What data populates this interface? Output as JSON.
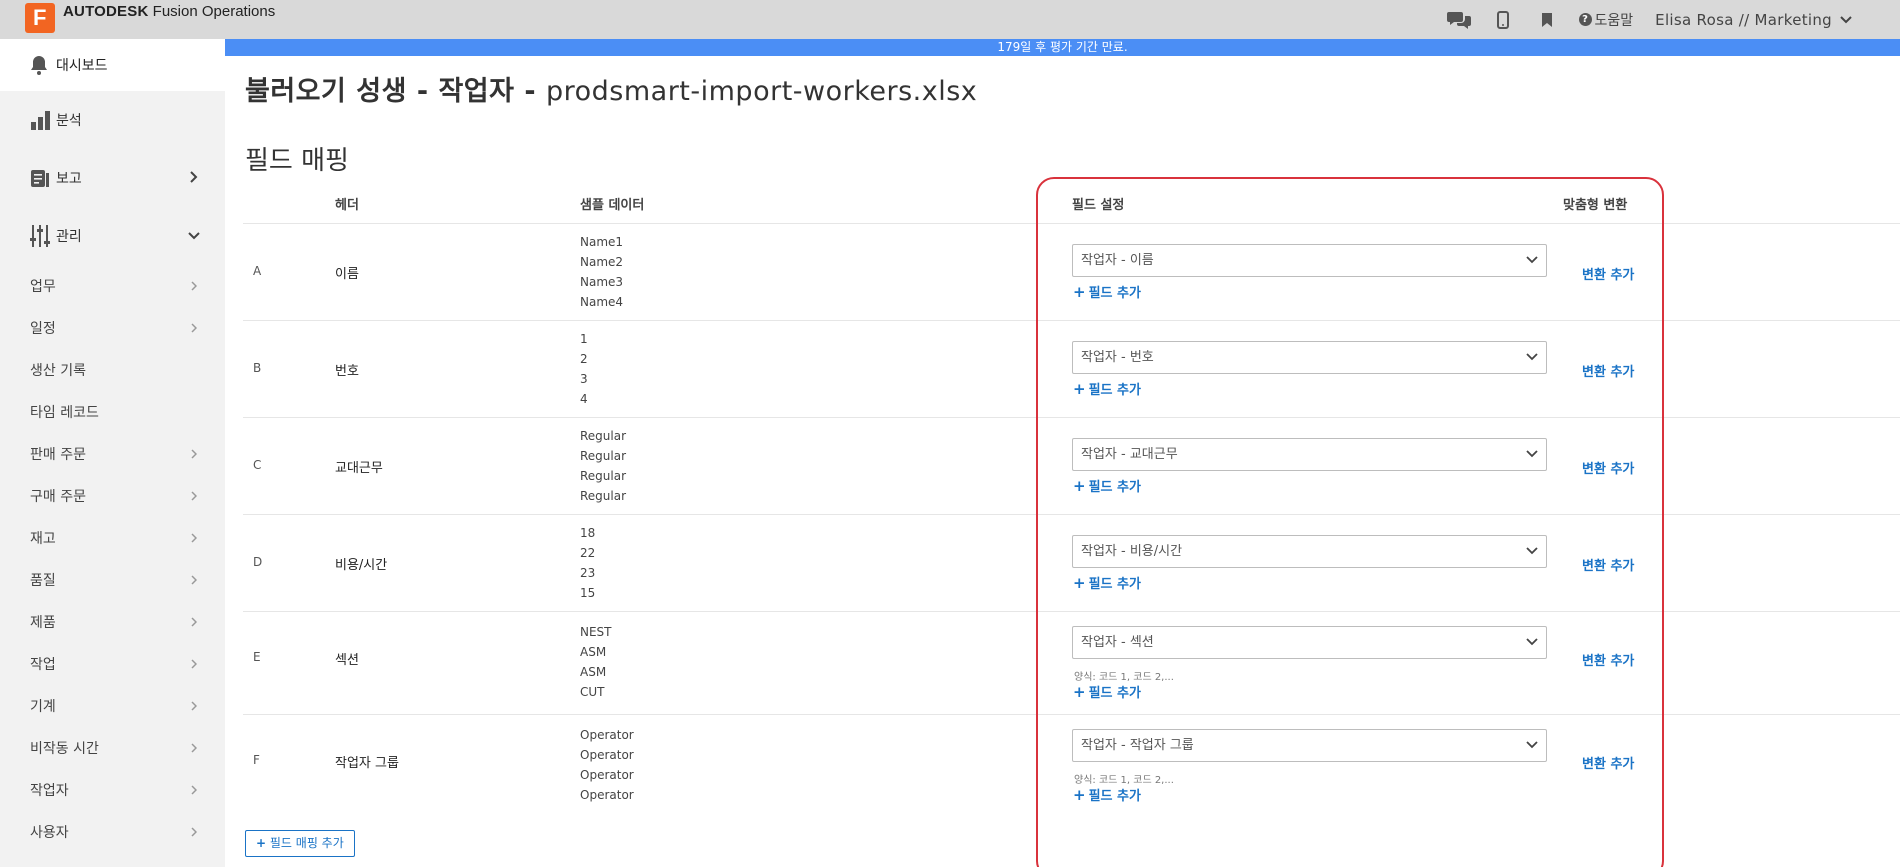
{
  "topbar": {
    "brand_bold": "AUTODESK",
    "brand_rest": " Fusion Operations",
    "help_label": "도움말",
    "user_label": "Elisa Rosa // Marketing"
  },
  "banner": {
    "text": "179일 후 평가 기간 만료."
  },
  "sidebar": {
    "dashboard": "대시보드",
    "analysis": "분석",
    "reports": "보고",
    "manage": "관리",
    "items": [
      "업무",
      "일정",
      "생산 기록",
      "타임 레코드",
      "판매 주문",
      "구매 주문",
      "재고",
      "품질",
      "제품",
      "작업",
      "기계",
      "비작동 시간",
      "작업자",
      "사용자"
    ]
  },
  "page": {
    "title_bold": "불러오기 성생 - 작업자 - ",
    "title_file": "prodsmart-import-workers.xlsx",
    "section_title": "필드 매핑",
    "col_header": "헤더",
    "col_sample": "샘플 데이터",
    "col_field": "필드 설정",
    "col_custom": "맞춤형 변환",
    "add_field_label": "필드 추가",
    "add_transform_label": "변환 추가",
    "add_mapping_label": "필드 매핑 추가"
  },
  "rows": [
    {
      "letter": "A",
      "header": "이름",
      "samples": [
        "Name1",
        "Name2",
        "Name3",
        "Name4"
      ],
      "field": "작업자 - 이름",
      "hint": ""
    },
    {
      "letter": "B",
      "header": "번호",
      "samples": [
        "1",
        "2",
        "3",
        "4"
      ],
      "field": "작업자 - 번호",
      "hint": ""
    },
    {
      "letter": "C",
      "header": "교대근무",
      "samples": [
        "Regular",
        "Regular",
        "Regular",
        "Regular"
      ],
      "field": "작업자 - 교대근무",
      "hint": ""
    },
    {
      "letter": "D",
      "header": "비용/시간",
      "samples": [
        "18",
        "22",
        "23",
        "15"
      ],
      "field": "작업자 - 비용/시간",
      "hint": ""
    },
    {
      "letter": "E",
      "header": "섹션",
      "samples": [
        "NEST",
        "ASM",
        "ASM",
        "CUT"
      ],
      "field": "작업자 - 섹션",
      "hint": "양식: 코드 1, 코드 2,..."
    },
    {
      "letter": "F",
      "header": "작업자 그룹",
      "samples": [
        "Operator",
        "Operator",
        "Operator",
        "Operator"
      ],
      "field": "작업자 - 작업자 그룹",
      "hint": "양식: 코드 1, 코드 2,..."
    }
  ]
}
